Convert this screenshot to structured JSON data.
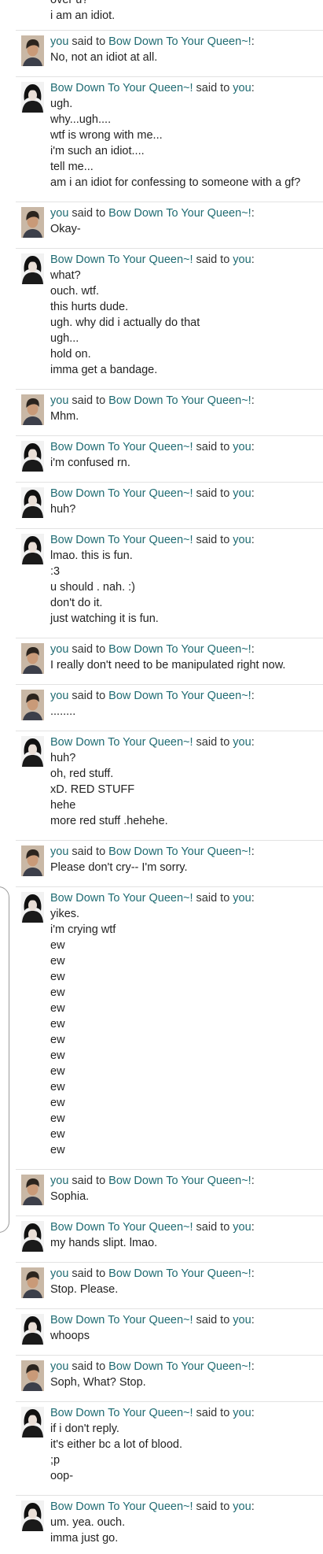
{
  "conversation": {
    "speakers": {
      "you": "you",
      "other": "Bow Down To Your Queen~!"
    },
    "said_to": "said to",
    "suffix": ":",
    "messages": [
      {
        "from": "other",
        "partial": true,
        "lines": [
          "over u?",
          "i am an idiot."
        ]
      },
      {
        "from": "you",
        "lines": [
          "No, not an idiot at all."
        ]
      },
      {
        "from": "other",
        "lines": [
          "ugh.",
          "why...ugh....",
          "wtf is wrong with me...",
          "i'm such an idiot....",
          "tell me...",
          "am i an idiot for confessing to someone with a gf?"
        ]
      },
      {
        "from": "you",
        "lines": [
          "Okay-"
        ]
      },
      {
        "from": "other",
        "lines": [
          "what?",
          "ouch. wtf.",
          "this hurts dude.",
          "ugh. why did i actually do that",
          "ugh...",
          "hold on.",
          "imma get a bandage."
        ]
      },
      {
        "from": "you",
        "lines": [
          "Mhm."
        ]
      },
      {
        "from": "other",
        "lines": [
          "i'm confused rn."
        ]
      },
      {
        "from": "other",
        "lines": [
          "huh?"
        ]
      },
      {
        "from": "other",
        "lines": [
          "lmao. this is fun.",
          ":3",
          "u should . nah. :)",
          "don't do it.",
          "just watching it is fun."
        ]
      },
      {
        "from": "you",
        "lines": [
          "I really don't need to be manipulated right now."
        ]
      },
      {
        "from": "you",
        "lines": [
          "........"
        ]
      },
      {
        "from": "other",
        "lines": [
          "huh?",
          "oh, red stuff.",
          "xD. RED STUFF",
          "hehe",
          "more red stuff .hehehe."
        ]
      },
      {
        "from": "you",
        "lines": [
          "Please don't cry-- I'm sorry."
        ]
      },
      {
        "from": "other",
        "lines": [
          "yikes.",
          "i'm crying wtf",
          "ew",
          "ew",
          "ew",
          "ew",
          "ew",
          "ew",
          "ew",
          "ew",
          "ew",
          "ew",
          "ew",
          "ew",
          "ew",
          "ew"
        ]
      },
      {
        "from": "you",
        "lines": [
          "Sophia."
        ]
      },
      {
        "from": "other",
        "lines": [
          "my hands slipt. lmao."
        ]
      },
      {
        "from": "you",
        "lines": [
          "Stop. Please."
        ]
      },
      {
        "from": "other",
        "lines": [
          "whoops"
        ]
      },
      {
        "from": "you",
        "lines": [
          "Soph, What? Stop."
        ]
      },
      {
        "from": "other",
        "lines": [
          "if i don't reply.",
          "it's either bc a lot of blood.",
          ";p",
          "oop-"
        ]
      },
      {
        "from": "other",
        "lines": [
          "um. yea. ouch.",
          "imma just go."
        ]
      }
    ]
  },
  "avatars": {
    "you": {
      "icon": "person-photo-icon",
      "bg": "#c9b8a6",
      "hair": "#2b241e",
      "skin": "#c99a78",
      "shirt": "#3c3f4a"
    },
    "other": {
      "icon": "dark-figure-icon",
      "bg": "#f2f2f2",
      "hair": "#111111",
      "skin": "#e9ded6",
      "shirt": "#1a1a1a"
    }
  },
  "colors": {
    "name_accent": "#1f6b72",
    "divider": "#e2e2e2",
    "text": "#222222"
  }
}
